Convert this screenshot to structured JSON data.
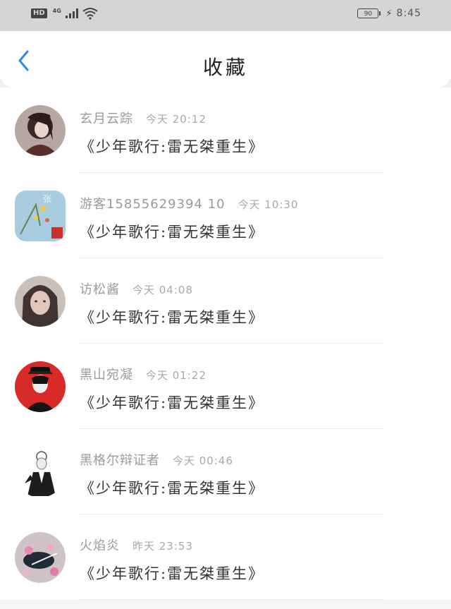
{
  "status_bar": {
    "hd": "HD",
    "network": "4G",
    "battery": "90",
    "time": "8:45"
  },
  "header": {
    "title": "收藏",
    "back_icon": "chevron-left-icon"
  },
  "favorites": [
    {
      "user": "玄月云踪",
      "time": "今天 20:12",
      "title": "《少年歌行:雷无桀重生》"
    },
    {
      "user": "游客15855629394 10",
      "time": "今天 10:30",
      "title": "《少年歌行:雷无桀重生》"
    },
    {
      "user": "访松酱",
      "time": "今天 04:08",
      "title": "《少年歌行:雷无桀重生》"
    },
    {
      "user": "黑山宛凝",
      "time": "今天 01:22",
      "title": "《少年歌行:雷无桀重生》"
    },
    {
      "user": "黑格尔辩证者",
      "time": "今天 00:46",
      "title": "《少年歌行:雷无桀重生》"
    },
    {
      "user": "火焰炎",
      "time": "昨天 23:53",
      "title": "《少年歌行:雷无桀重生》"
    }
  ],
  "colors": {
    "accent": "#2f8ae5",
    "status_bar_bg": "#d4d5d7",
    "page_bg": "#f4f5f7"
  }
}
